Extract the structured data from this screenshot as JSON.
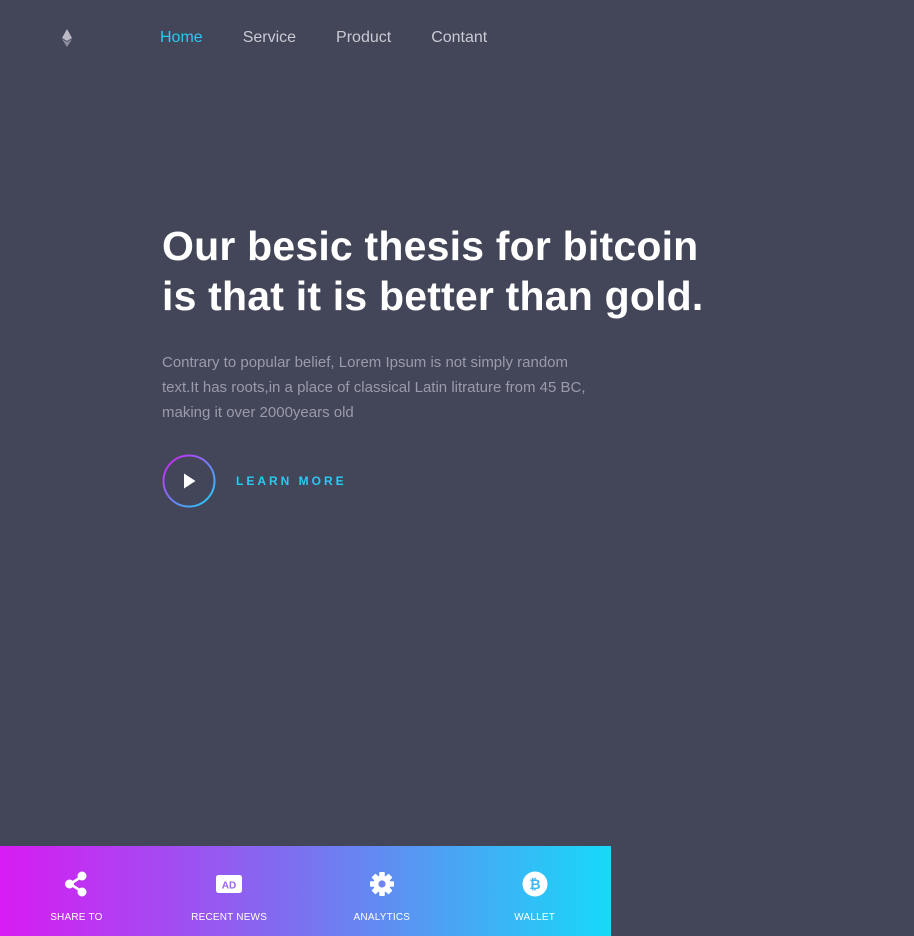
{
  "nav": {
    "logo_icon": "ethereum-icon",
    "items": [
      {
        "label": "Home",
        "active": true
      },
      {
        "label": "Service",
        "active": false
      },
      {
        "label": "Product",
        "active": false
      },
      {
        "label": "Contant",
        "active": false
      }
    ]
  },
  "hero": {
    "title_line1": "Our besic thesis for bitcoin",
    "title_line2": "is that it is better than gold.",
    "description": "Contrary to popular belief, Lorem Ipsum is not simply random text.It has roots,in a place of classical Latin litrature from 45 BC, making it over 2000years old",
    "cta_label": "LEARN MORE",
    "cta_icon": "play-icon"
  },
  "bottom_bar": {
    "items": [
      {
        "label": "SHARE TO",
        "icon": "share-icon"
      },
      {
        "label": "RECENT NEWS",
        "icon": "ad-icon"
      },
      {
        "label": "ANALYTICS",
        "icon": "gear-icon"
      },
      {
        "label": "WALLET",
        "icon": "bitcoin-icon"
      }
    ]
  },
  "colors": {
    "background": "#434559",
    "accent": "#29c9f2",
    "gradient_start": "#d81bf3",
    "gradient_end": "#17d9f8",
    "nav_text": "#c9cad3",
    "muted_text": "#9a9cab"
  }
}
